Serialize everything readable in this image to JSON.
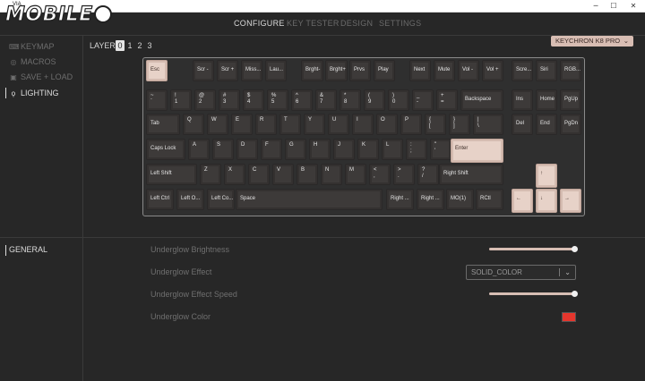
{
  "window": {
    "title": "VIA",
    "minimize": "─",
    "maximize": "☐",
    "close": "✕"
  },
  "watermark": {
    "text": "MOBILE"
  },
  "topnav": {
    "tabs": [
      {
        "label": "CONFIGURE"
      },
      {
        "label": "KEY TESTER"
      },
      {
        "label": "DESIGN"
      },
      {
        "label": "SETTINGS"
      }
    ]
  },
  "sidebar": {
    "items": [
      {
        "label": "KEYMAP",
        "icon": "keyboard-icon",
        "glyph": "⌨"
      },
      {
        "label": "MACROS",
        "icon": "record-icon",
        "glyph": "◎"
      },
      {
        "label": "SAVE + LOAD",
        "icon": "save-icon",
        "glyph": "▣"
      },
      {
        "label": "LIGHTING",
        "icon": "lightbulb-icon",
        "glyph": "ϙ"
      }
    ]
  },
  "layer": {
    "label": "LAYER",
    "layers": [
      "0",
      "1",
      "2",
      "3"
    ],
    "selected": "0"
  },
  "keyboard_select": {
    "value": "KEYCHRON K8 PRO",
    "chevron": "⌄"
  },
  "keys": {
    "esc": "Esc",
    "f1": "Scr -",
    "f2": "Scr +",
    "f3": "Miss...",
    "f4": "Lau...",
    "f5": "Brght-",
    "f6": "Brght+",
    "f7": "Prvs",
    "f8": "Play",
    "f9": "Next",
    "f10": "Mute",
    "f11": "Vol -",
    "f12": "Vol +",
    "prt": "Scre...",
    "scr": "Siri",
    "pause": "RGB...",
    "tilde": [
      "~",
      "`"
    ],
    "n1": [
      "!",
      "1"
    ],
    "n2": [
      "@",
      "2"
    ],
    "n3": [
      "#",
      "3"
    ],
    "n4": [
      "$",
      "4"
    ],
    "n5": [
      "%",
      "5"
    ],
    "n6": [
      "^",
      "6"
    ],
    "n7": [
      "&",
      "7"
    ],
    "n8": [
      "*",
      "8"
    ],
    "n9": [
      "(",
      "9"
    ],
    "n0": [
      ")",
      "0"
    ],
    "minus": [
      "_",
      "-"
    ],
    "equal": [
      "+",
      "="
    ],
    "backspace": "Backspace",
    "ins": "Ins",
    "home": "Home",
    "pgup": "PgUp",
    "tab": "Tab",
    "q": "Q",
    "w": "W",
    "e": "E",
    "r": "R",
    "t": "T",
    "y": "Y",
    "u": "U",
    "i": "I",
    "o": "O",
    "p": "P",
    "lbracket": [
      "{",
      "["
    ],
    "rbracket": [
      "}",
      "]"
    ],
    "backslash": [
      "|",
      "\\"
    ],
    "del": "Del",
    "end": "End",
    "pgdn": "PgDn",
    "caps": "Caps Lock",
    "a": "A",
    "s": "S",
    "d": "D",
    "f": "F",
    "g": "G",
    "h": "H",
    "j": "J",
    "k": "K",
    "l": "L",
    "semicolon": [
      ":",
      ";"
    ],
    "quote": [
      "\"",
      "'"
    ],
    "enter": "Enter",
    "lshift": "Left Shift",
    "z": "Z",
    "x": "X",
    "c": "C",
    "v": "V",
    "b": "B",
    "n": "N",
    "m": "M",
    "comma": [
      "<",
      ","
    ],
    "period": [
      ">",
      "."
    ],
    "slash": [
      "?",
      "/"
    ],
    "rshift": "Right Shift",
    "up": "↑",
    "lctrl": "Left Ctrl",
    "lopt": "Left O...",
    "lcmd": "Left Co...",
    "space": "Space",
    "rcmd": "Right ...",
    "ropt": "Right ...",
    "mo1": "MO(1)",
    "rctrl": "RCtl",
    "left": "←",
    "down": "↓",
    "right": "→"
  },
  "general": {
    "label": "GENERAL",
    "rows": [
      {
        "label": "Underglow Brightness",
        "value": 1.0
      },
      {
        "label": "Underglow Effect",
        "value": "SOLID_COLOR",
        "chevron": "⌄"
      },
      {
        "label": "Underglow Effect Speed",
        "value": 1.0
      },
      {
        "label": "Underglow Color",
        "color": "#e5362d"
      }
    ]
  },
  "colors": {
    "accent": "#e7d2c8",
    "background": "#272727",
    "key": "#3d3a39",
    "underglow": "#e5362d"
  }
}
